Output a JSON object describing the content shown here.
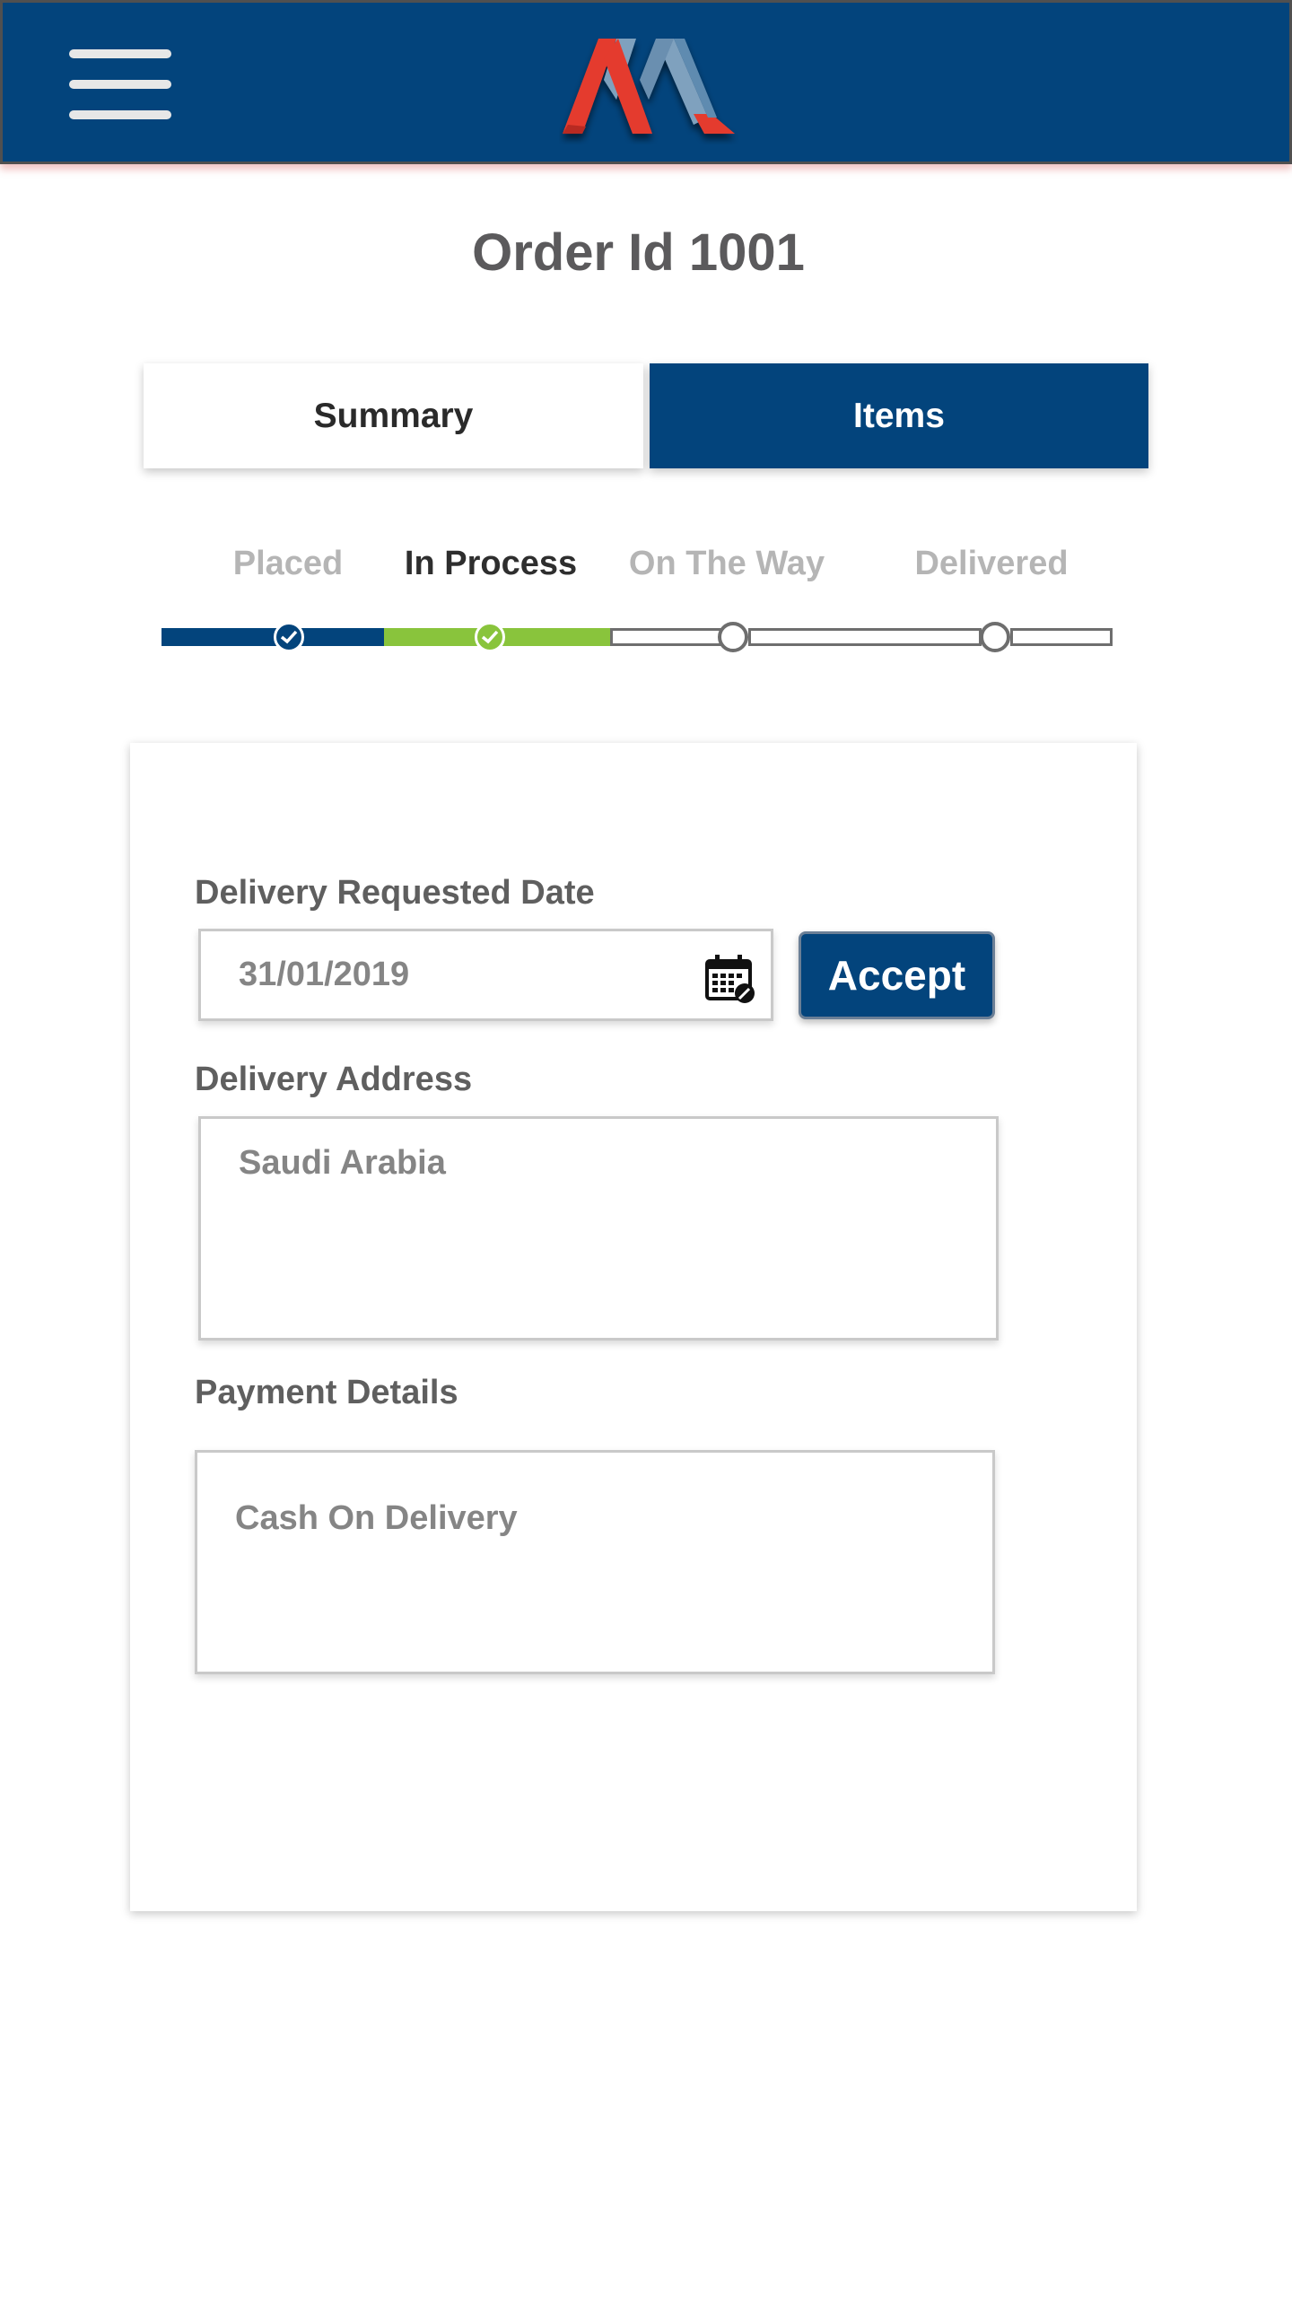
{
  "header": {
    "menu_icon": "hamburger-menu-icon",
    "logo_icon": "brand-logo",
    "colors": {
      "background": "#03447c",
      "logo_red": "#e43b2d",
      "logo_light": "#7fa1be"
    }
  },
  "page": {
    "title": "Order Id 1001"
  },
  "tabs": [
    {
      "label": "Summary",
      "active": false
    },
    {
      "label": "Items",
      "active": true
    }
  ],
  "stepper": {
    "steps": [
      {
        "label": "Placed",
        "state": "done",
        "color": "#b5b5b5"
      },
      {
        "label": "In Process",
        "state": "current",
        "color": "#2e2e2e"
      },
      {
        "label": "On The Way",
        "state": "pending",
        "color": "#b5b5b5"
      },
      {
        "label": "Delivered",
        "state": "pending",
        "color": "#b5b5b5"
      }
    ],
    "colors": {
      "done": "#03447c",
      "current": "#89c43c"
    }
  },
  "form": {
    "delivery_date_label": "Delivery Requested Date",
    "delivery_date_value": "31/01/2019",
    "calendar_icon": "calendar-edit-icon",
    "accept_label": "Accept",
    "delivery_address_label": "Delivery Address",
    "delivery_address_value": "Saudi Arabia",
    "payment_label": "Payment Details",
    "payment_value": "Cash On Delivery"
  }
}
